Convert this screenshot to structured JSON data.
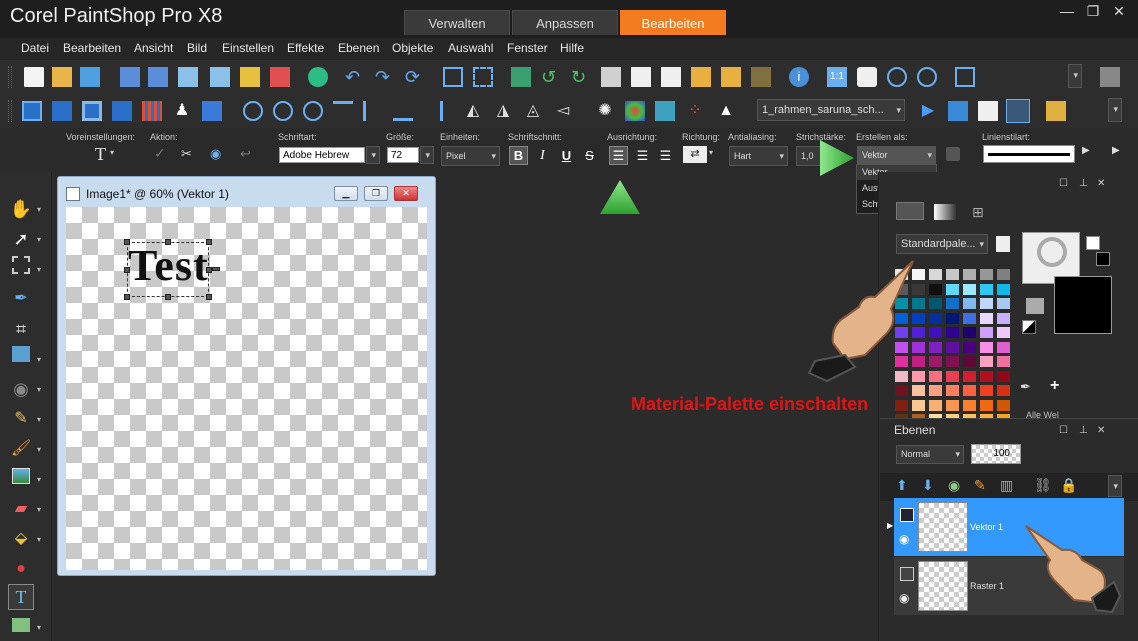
{
  "app": {
    "title": "Corel PaintShop Pro X8"
  },
  "workspace_tabs": [
    {
      "label": "Verwalten"
    },
    {
      "label": "Anpassen"
    },
    {
      "label": "Bearbeiten",
      "active": true
    }
  ],
  "menu": [
    "Datei",
    "Bearbeiten",
    "Ansicht",
    "Bild",
    "Einstellen",
    "Effekte",
    "Ebenen",
    "Objekte",
    "Auswahl",
    "Fenster",
    "Hilfe"
  ],
  "toolbar2": {
    "script_combo": "1_rahmen_saruna_sch..."
  },
  "tool_options": {
    "labels": {
      "presets": "Voreinstellungen:",
      "action": "Aktion:",
      "font": "Schriftart:",
      "size": "Größe:",
      "units": "Einheiten:",
      "style": "Schriftschnitt:",
      "alignment": "Ausrichtung:",
      "direction": "Richtung:",
      "antialias": "Antialiasing:",
      "stroke": "Strichstärke:",
      "create_as": "Erstellen als:",
      "line_style": "Linienstilart:"
    },
    "font_value": "Adobe Hebrew",
    "size_value": "72",
    "units_value": "Pixel",
    "antialias_value": "Hart",
    "stroke_value": "1,0",
    "create_as_value": "Vektor",
    "style_buttons": {
      "bold": "B",
      "italic": "I",
      "underline": "U",
      "strike": "S"
    },
    "presets_glyph": "T"
  },
  "create_as_dropdown": {
    "items": [
      "Vektor",
      "Auswahl",
      "Schwebend"
    ],
    "selected": "Vektor"
  },
  "document": {
    "title": "Image1* @ 60% (Vektor 1)",
    "canvas_text": "Test"
  },
  "materials": {
    "palette_combo": "Standardpale...",
    "all_label": "Alle Wel",
    "annotation": "Material-Palette einschalten",
    "annotation_color": "#e01414",
    "swatch_rows": [
      [
        "#e8e8e8",
        "#f5f5f5",
        "#d8d8d8",
        "#c8c8c8",
        "#b0b0b0",
        "#989898",
        "#808080"
      ],
      [
        "#5a5a5a",
        "#383838",
        "#101010",
        "#60d8f8",
        "#9ce8ff",
        "#30c8f0",
        "#10b8e8"
      ],
      [
        "#0090a8",
        "#007890",
        "#005870",
        "#1070c8",
        "#80b8f0",
        "#c0d8f8",
        "#a8c8f0"
      ],
      [
        "#0060d8",
        "#0040c0",
        "#0030a0",
        "#001878",
        "#4070e0",
        "#e8d8ff",
        "#c8b0ff"
      ],
      [
        "#7040f0",
        "#5020d8",
        "#4010c0",
        "#300090",
        "#200070",
        "#d0a0f8",
        "#f0c8ff"
      ],
      [
        "#c050f0",
        "#a030d8",
        "#8020c0",
        "#6010a0",
        "#480080",
        "#f890e8",
        "#e060d0"
      ],
      [
        "#e0309c",
        "#c02080",
        "#a01868",
        "#801050",
        "#600838",
        "#f8a0c0",
        "#f070a0"
      ],
      [
        "#f0b8c8",
        "#ff98a8",
        "#f87080",
        "#e84050",
        "#d02030",
        "#b01020",
        "#900818"
      ],
      [
        "#701020",
        "#ffc0a0",
        "#ffa080",
        "#ff8060",
        "#ff6040",
        "#f04020",
        "#d83010"
      ],
      [
        "#802010",
        "#f8c890",
        "#f8b070",
        "#f89850",
        "#f88030",
        "#f06810",
        "#d05800"
      ],
      [
        "#603010",
        "#b06020",
        "#ffe0a0",
        "#ffd080",
        "#ffc060",
        "#ffb040",
        "#f8a020"
      ]
    ]
  },
  "layers": {
    "title": "Ebenen",
    "blend_mode": "Normal",
    "opacity": "100",
    "items": [
      {
        "name": "Vektor 1",
        "selected": true
      },
      {
        "name": "Raster 1",
        "selected": false
      }
    ]
  },
  "colors": {
    "accent": "#f47b20",
    "selection": "#3399ff",
    "background": "#2b2b2b",
    "arrow_green": "#3fbf3f"
  }
}
